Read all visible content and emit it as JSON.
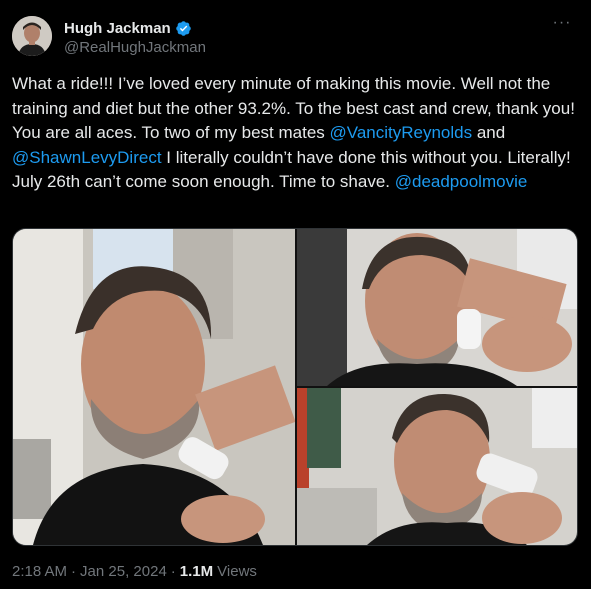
{
  "author": {
    "display_name": "Hugh Jackman",
    "handle": "@RealHughJackman",
    "verified": true,
    "more_icon": "more-horizontal-icon"
  },
  "tweet": {
    "text_part1": "What a ride!!! I’ve loved every minute of making this movie. Well not the training and diet but the other 93.2%. To the best cast and crew, thank you! You are all aces. To two of my best mates ",
    "mention1": "@VancityReynolds",
    "text_part2": " and ",
    "mention2": "@ShawnLevyDirect",
    "text_part3": " I literally couldn’t have done this without you. Literally! July 26th can’t come soon enough. Time to shave. ",
    "mention3": "@deadpoolmovie"
  },
  "media": {
    "photo_count": 3
  },
  "meta": {
    "time": "2:18 AM",
    "separator1": "·",
    "date": "Jan 25, 2024",
    "separator2": "·",
    "views_count": "1.1M",
    "views_label": "Views"
  },
  "colors": {
    "background": "#000000",
    "text": "#e7e9ea",
    "secondary": "#71767b",
    "link": "#1d9bf0",
    "verified": "#1d9bf0"
  }
}
